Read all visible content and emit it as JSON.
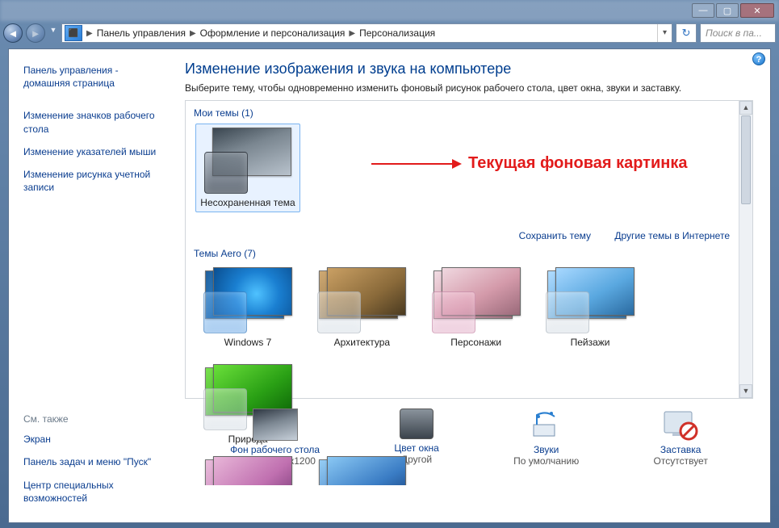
{
  "window": {
    "breadcrumbs": [
      "Панель управления",
      "Оформление и персонализация",
      "Персонализация"
    ],
    "search_placeholder": "Поиск в па..."
  },
  "sidebar": {
    "home_line1": "Панель управления -",
    "home_line2": "домашняя страница",
    "links": [
      "Изменение значков рабочего стола",
      "Изменение указателей мыши",
      "Изменение рисунка учетной записи"
    ],
    "seealso_header": "См. также",
    "seealso": [
      "Экран",
      "Панель задач и меню \"Пуск\"",
      "Центр специальных возможностей"
    ]
  },
  "main": {
    "heading": "Изменение изображения и звука на компьютере",
    "description": "Выберите тему, чтобы одновременно изменить фоновый рисунок рабочего стола, цвет окна, звуки и заставку.",
    "my_themes_header": "Мои темы (1)",
    "my_theme_label": "Несохраненная тема",
    "save_theme_link": "Сохранить тему",
    "more_themes_link": "Другие темы в Интернете",
    "aero_header": "Темы Aero (7)",
    "aero": [
      "Windows 7",
      "Архитектура",
      "Персонажи",
      "Пейзажи",
      "Природа"
    ]
  },
  "annotation": "Текущая фоновая картинка",
  "bottom": {
    "bg": {
      "title": "Фон рабочего стола",
      "sub": "skyrim_1920x1200"
    },
    "color": {
      "title": "Цвет окна",
      "sub": "Другой"
    },
    "sound": {
      "title": "Звуки",
      "sub": "По умолчанию"
    },
    "saver": {
      "title": "Заставка",
      "sub": "Отсутствует"
    }
  }
}
